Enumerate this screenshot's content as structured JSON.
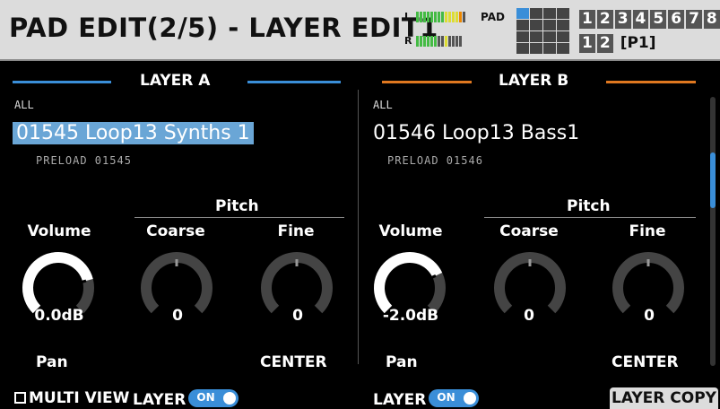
{
  "header": {
    "title": "PAD EDIT(2/5) - LAYER EDIT1",
    "meter_l": "L",
    "meter_r": "R",
    "pad_label": "PAD",
    "bank_numbers": [
      "1",
      "2",
      "3",
      "4",
      "5",
      "6",
      "7",
      "8"
    ],
    "sub_numbers": [
      "1",
      "2"
    ],
    "page": "[P1]"
  },
  "layer_a": {
    "title": "LAYER A",
    "line_color": "#3a8ed8",
    "all_label": "ALL",
    "sample": "01545 Loop13 Synths 1",
    "preload": "PRELOAD 01545",
    "pitch_label": "Pitch",
    "volume_label": "Volume",
    "coarse_label": "Coarse",
    "fine_label": "Fine",
    "volume_value": "0.0dB",
    "volume_level": 0.78,
    "coarse_value": "0",
    "fine_value": "0",
    "pan_label": "Pan",
    "pan_value": "CENTER"
  },
  "layer_b": {
    "title": "LAYER B",
    "line_color": "#e07820",
    "all_label": "ALL",
    "sample": "01546 Loop13 Bass1",
    "preload": "PRELOAD 01546",
    "pitch_label": "Pitch",
    "volume_label": "Volume",
    "coarse_label": "Coarse",
    "fine_label": "Fine",
    "volume_value": "-2.0dB",
    "volume_level": 0.74,
    "coarse_value": "0",
    "fine_value": "0",
    "pan_label": "Pan",
    "pan_value": "CENTER"
  },
  "bottom": {
    "multi_view": "MULTI VIEW",
    "layer_a_label": "LAYER",
    "layer_a_toggle": "ON",
    "layer_b_label": "LAYER",
    "layer_b_toggle": "ON",
    "layer_copy": "LAYER COPY"
  },
  "colors": {
    "accent_blue": "#3a8ed8",
    "accent_orange": "#e07820",
    "selected_bg": "#6aa6d6"
  }
}
